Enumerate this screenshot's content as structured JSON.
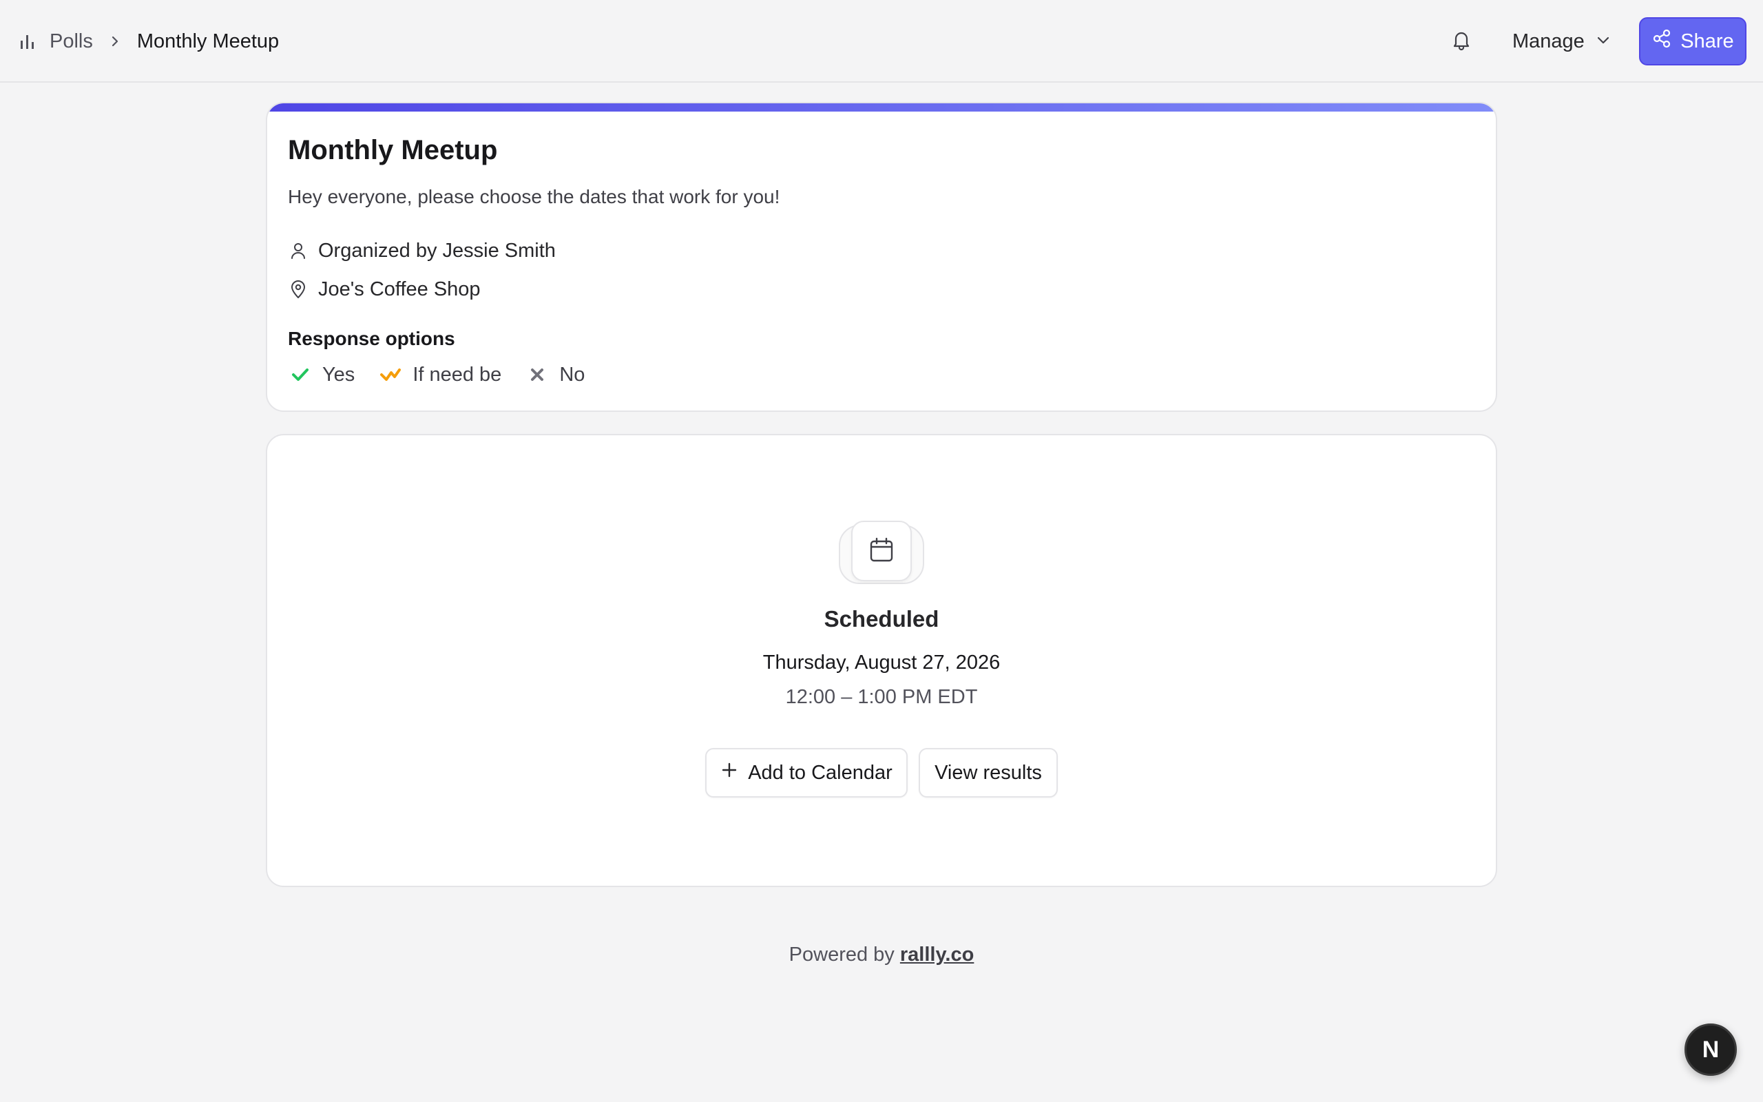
{
  "header": {
    "breadcrumb": {
      "root_label": "Polls",
      "current_label": "Monthly Meetup"
    },
    "manage_label": "Manage",
    "share_label": "Share",
    "accent_color": "#6366f1"
  },
  "poll": {
    "title": "Monthly Meetup",
    "description": "Hey everyone, please choose the dates that work for you!",
    "organizer": "Organized by Jessie Smith",
    "location": "Joe's Coffee Shop",
    "response_options_heading": "Response options",
    "response_options": [
      {
        "label": "Yes",
        "icon": "check-icon",
        "color": "#22c55e"
      },
      {
        "label": "If need be",
        "icon": "check-wave-icon",
        "color": "#f59e0b"
      },
      {
        "label": "No",
        "icon": "x-icon",
        "color": "#71717a"
      }
    ]
  },
  "schedule": {
    "status": "Scheduled",
    "date": "Thursday, August 27, 2026",
    "time": "12:00 – 1:00 PM EDT",
    "add_to_calendar_label": "Add to Calendar",
    "view_results_label": "View results"
  },
  "footer": {
    "prefix": "Powered by",
    "link_label": "rallly.co"
  },
  "dev_badge": {
    "label": "N"
  }
}
